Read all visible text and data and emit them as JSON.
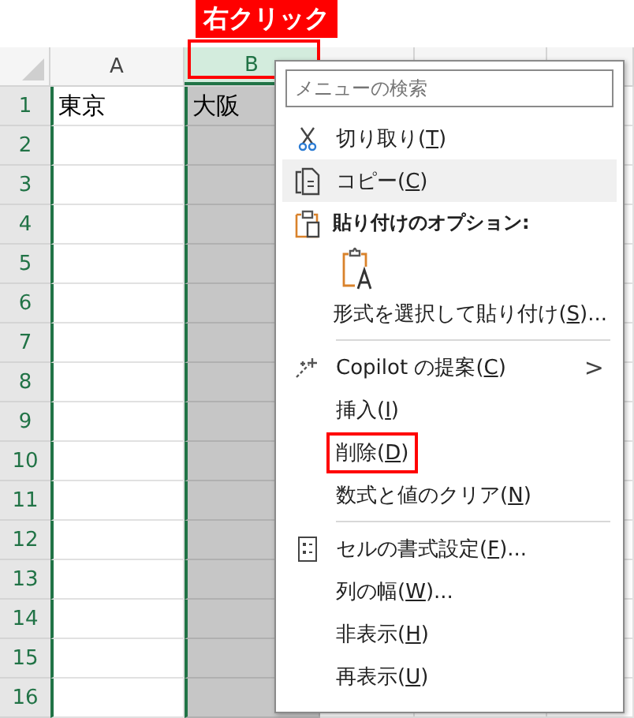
{
  "callout": {
    "label": "右クリック"
  },
  "columns": [
    {
      "label": "A",
      "selected": false
    },
    {
      "label": "B",
      "selected": true
    },
    {
      "selected": false
    },
    {
      "selected": false
    },
    {
      "selected": false
    }
  ],
  "rows": [
    {
      "label": "1",
      "cells": [
        "東京",
        "大阪"
      ]
    },
    {
      "label": "2",
      "cells": []
    },
    {
      "label": "3",
      "cells": []
    },
    {
      "label": "4",
      "cells": []
    },
    {
      "label": "5",
      "cells": []
    },
    {
      "label": "6",
      "cells": []
    },
    {
      "label": "7",
      "cells": []
    },
    {
      "label": "8",
      "cells": []
    },
    {
      "label": "9",
      "cells": []
    },
    {
      "label": "10",
      "cells": []
    },
    {
      "label": "11",
      "cells": []
    },
    {
      "label": "12",
      "cells": []
    },
    {
      "label": "13",
      "cells": []
    },
    {
      "label": "14",
      "cells": []
    },
    {
      "label": "15",
      "cells": []
    },
    {
      "label": "16",
      "cells": []
    }
  ],
  "context_menu": {
    "search": {
      "placeholder": "メニューの検索"
    },
    "items": [
      {
        "kind": "cut",
        "text": "切り取り(",
        "key": "T",
        "after": ")",
        "hovered": false,
        "highlighted": false
      },
      {
        "kind": "copy",
        "text": "コピー(",
        "key": "C",
        "after": ")",
        "hovered": true,
        "highlighted": false
      },
      {
        "kind": "paste-header",
        "text": "貼り付けのオプション:"
      },
      {
        "kind": "paste-option"
      },
      {
        "kind": "plain",
        "text": "形式を選択して貼り付け(",
        "key": "S",
        "after": ")...",
        "hovered": false,
        "highlighted": false
      },
      {
        "kind": "separator"
      },
      {
        "kind": "submenu",
        "text": "Copilot の提案(",
        "key": "C",
        "after": ")",
        "arrow": ">",
        "hovered": false,
        "highlighted": false
      },
      {
        "kind": "plain",
        "text": "挿入(",
        "key": "I",
        "after": ")",
        "hovered": false,
        "highlighted": false
      },
      {
        "kind": "plain",
        "text": "削除(",
        "key": "D",
        "after": ")",
        "hovered": false,
        "highlighted": true
      },
      {
        "kind": "plain",
        "text": "数式と値のクリア(",
        "key": "N",
        "after": ")",
        "hovered": false,
        "highlighted": false
      },
      {
        "kind": "separator"
      },
      {
        "kind": "format",
        "text": "セルの書式設定(",
        "key": "F",
        "after": ")...",
        "hovered": false,
        "highlighted": false
      },
      {
        "kind": "plain",
        "text": "列の幅(",
        "key": "W",
        "after": ")...",
        "hovered": false,
        "highlighted": false
      },
      {
        "kind": "plain",
        "text": "非表示(",
        "key": "H",
        "after": ")",
        "hovered": false,
        "highlighted": false
      },
      {
        "kind": "plain",
        "text": "再表示(",
        "key": "U",
        "after": ")",
        "hovered": false,
        "highlighted": false
      }
    ]
  }
}
